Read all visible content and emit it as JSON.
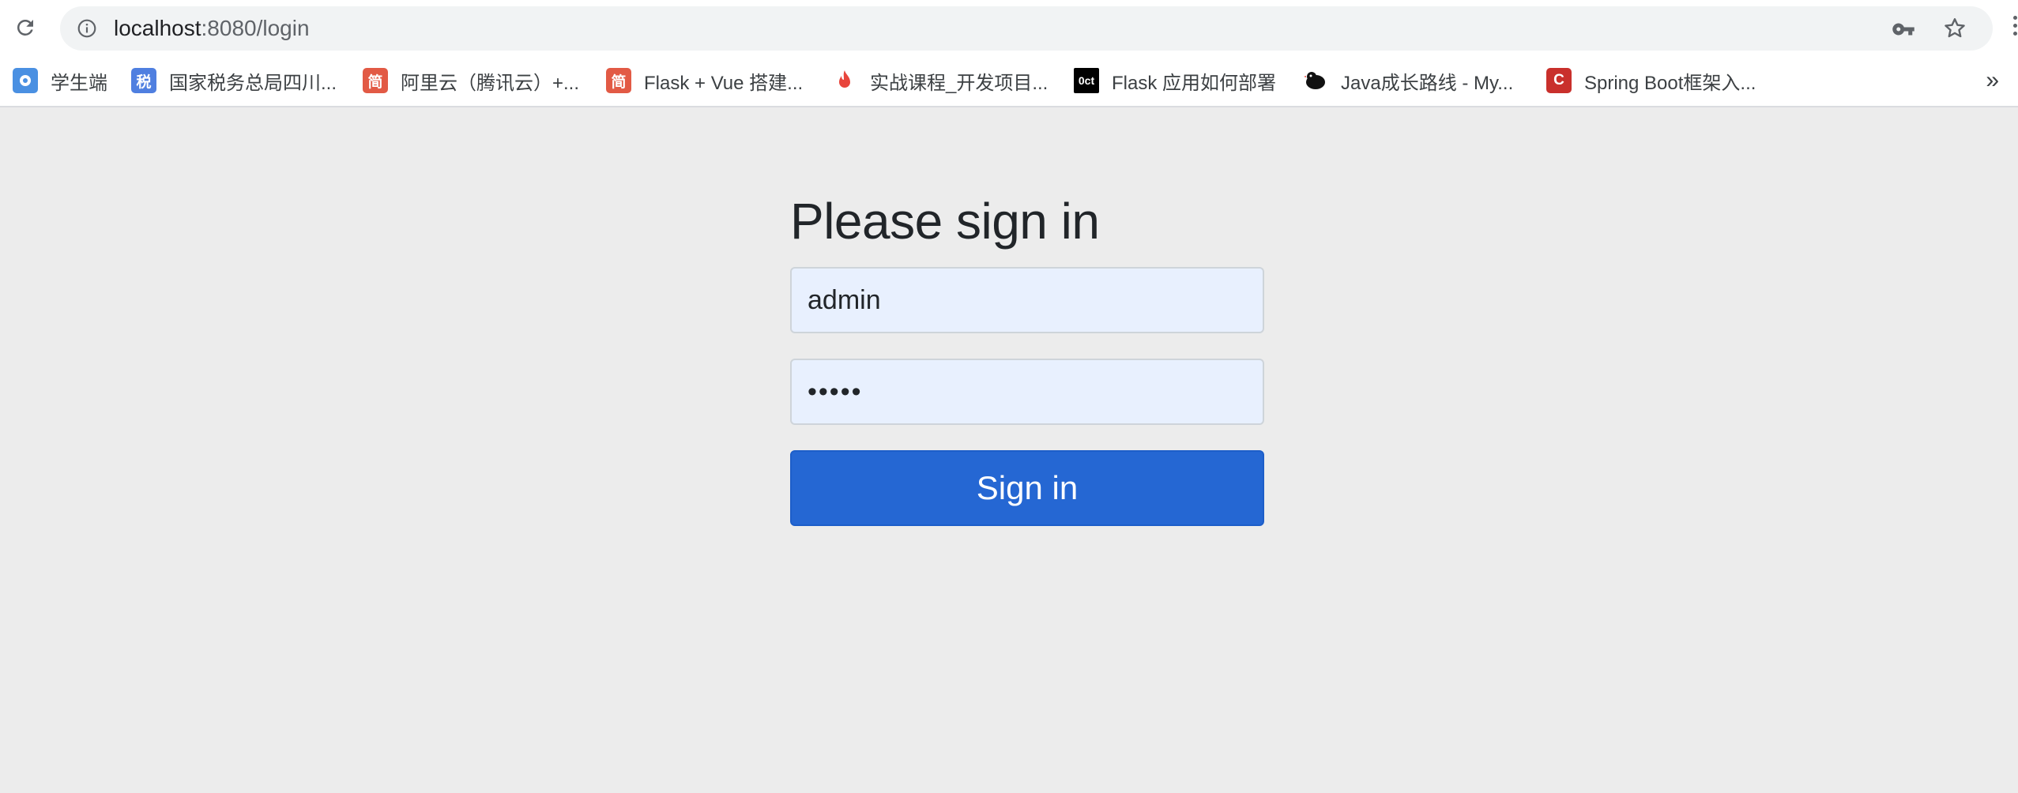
{
  "browser": {
    "url_host": "localhost",
    "url_path": ":8080/login",
    "bookmarks": [
      {
        "label": "学生端",
        "favicon": "circle-app-icon",
        "color": "#4a90e2",
        "glyph": ""
      },
      {
        "label": "国家税务总局四川...",
        "favicon": "tax-icon",
        "color": "#4f7fe0",
        "glyph": "税"
      },
      {
        "label": "阿里云（腾讯云）+...",
        "favicon": "jianshu-icon",
        "color": "#e25a45",
        "glyph": "简"
      },
      {
        "label": "Flask + Vue 搭建...",
        "favicon": "jianshu-icon",
        "color": "#e25a45",
        "glyph": "简"
      },
      {
        "label": "实战课程_开发项目...",
        "favicon": "flame-icon",
        "color": "#e8453c",
        "glyph": ""
      },
      {
        "label": "Flask 应用如何部署",
        "favicon": "oct-icon",
        "color": "#000000",
        "glyph": "0ct"
      },
      {
        "label": "Java成长路线 - My...",
        "favicon": "bird-icon",
        "color": "#000000",
        "glyph": ""
      },
      {
        "label": "Spring Boot框架入...",
        "favicon": "csdn-icon",
        "color": "#c9302c",
        "glyph": "C"
      }
    ],
    "more_label": "»"
  },
  "login": {
    "heading": "Please sign in",
    "username": "admin",
    "password_mask": "•••••",
    "submit_label": "Sign in"
  }
}
